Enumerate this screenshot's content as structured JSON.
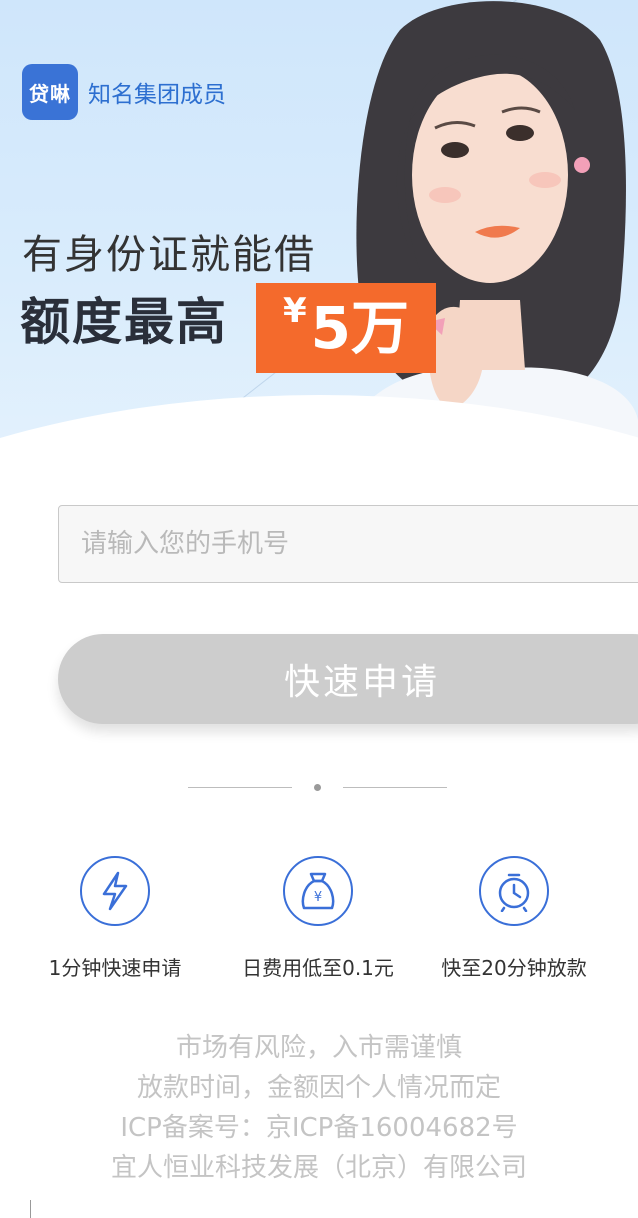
{
  "brand": {
    "logo_text": "贷啉",
    "tagline": "知名集团成员",
    "color": "#3a73d6"
  },
  "hero": {
    "headline": "有身份证就能借",
    "subheadline": "额度最高",
    "amount_currency": "¥",
    "amount_value": "5万",
    "accent_color": "#f46a2c"
  },
  "form": {
    "phone_placeholder": "请输入您的手机号",
    "phone_value": "",
    "submit_label": "快速申请"
  },
  "features": [
    {
      "icon": "lightning-icon",
      "label": "1分钟快速申请"
    },
    {
      "icon": "money-bag-icon",
      "label": "日费用低至0.1元"
    },
    {
      "icon": "alarm-clock-icon",
      "label": "快至20分钟放款"
    }
  ],
  "footer": {
    "lines": [
      "市场有风险，入市需谨慎",
      "放款时间，金额因个人情况而定",
      "ICP备案号：京ICP备16004682号",
      "宜人恒业科技发展（北京）有限公司"
    ]
  }
}
